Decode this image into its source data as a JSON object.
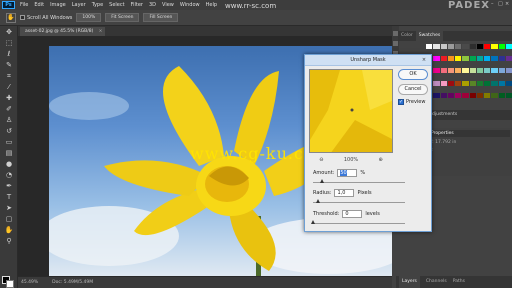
{
  "menubar": {
    "logo": "Ps",
    "items": [
      "File",
      "Edit",
      "Image",
      "Layer",
      "Type",
      "Select",
      "Filter",
      "3D",
      "View",
      "Window",
      "Help"
    ]
  },
  "watermark_top": "www.rr-sc.com",
  "watermark_center": "www.cg-ku.com",
  "brand_badge": "PADEX",
  "options_bar": {
    "scroll_all_windows": "Scroll All Windows",
    "zoom_value": "100%",
    "fit_screen": "Fit Screen",
    "fill_screen": "Fill Screen"
  },
  "document": {
    "tab_title": "asset-02.jpg @ 45.5% (RGB/8)",
    "tab_close": "×"
  },
  "status": {
    "zoom": "45.49%",
    "doc_size": "Doc: 5.49M/5.49M"
  },
  "panels": {
    "swatch_tabs": [
      "Color",
      "Swatches"
    ],
    "libraries_tab": "Adjustments",
    "properties_title": "Properties",
    "properties_w": "W: 17.792 in",
    "properties_h": "H:",
    "layers_tabs": [
      "Layers",
      "Channels",
      "Paths"
    ]
  },
  "swatch_colors": [
    "#ffffff",
    "#e6e6e6",
    "#c8c8c8",
    "#9b9b9b",
    "#6e6e6e",
    "#4a4a4a",
    "#2e2e2e",
    "#000000",
    "#ff0000",
    "#ffff00",
    "#00ff00",
    "#00ffff",
    "#0000ff",
    "#ff00ff",
    "#ed1c24",
    "#f7941d",
    "#fff200",
    "#8dc63f",
    "#00a651",
    "#00a99d",
    "#00aeef",
    "#0072bc",
    "#2e3192",
    "#662d91",
    "#92278f",
    "#ec008c",
    "#f26d7d",
    "#f69679",
    "#fbaf5d",
    "#fff799",
    "#c4df9b",
    "#82ca9c",
    "#7accc8",
    "#6dcff6",
    "#7da7d9",
    "#8393ca",
    "#a186be",
    "#bd8cbf",
    "#f49ac1",
    "#9e0b0f",
    "#a0410d",
    "#aba000",
    "#598527",
    "#197b30",
    "#007236",
    "#00746b",
    "#0076a3",
    "#004a80",
    "#003471",
    "#1b1464",
    "#440e62",
    "#630460",
    "#9e005d",
    "#9e0039",
    "#790000",
    "#7b2e00",
    "#827b00",
    "#406618",
    "#005e20",
    "#005826"
  ],
  "dialog": {
    "title": "Unsharp Mask",
    "close": "×",
    "ok_label": "OK",
    "cancel_label": "Cancel",
    "preview_label": "Preview",
    "preview_check": "✓",
    "preview_zoom": "100%",
    "zoom_in": "⊕",
    "zoom_out": "⊖",
    "amount_label": "Amount:",
    "amount_value": "50",
    "amount_unit": "%",
    "radius_label": "Radius:",
    "radius_value": "1,0",
    "radius_unit": "Pixels",
    "threshold_label": "Threshold:",
    "threshold_value": "0",
    "threshold_unit": "levels",
    "amount_fraction": 0.1,
    "radius_fraction": 0.06,
    "threshold_fraction": 0.0
  },
  "tool_icons": [
    "move-icon",
    "marquee-icon",
    "lasso-icon",
    "quick-select-icon",
    "crop-icon",
    "eyedropper-icon",
    "healing-icon",
    "brush-icon",
    "stamp-icon",
    "history-brush-icon",
    "eraser-icon",
    "gradient-icon",
    "blur-icon",
    "dodge-icon",
    "pen-icon",
    "type-icon",
    "path-select-icon",
    "shape-icon",
    "hand-icon",
    "zoom-icon"
  ]
}
